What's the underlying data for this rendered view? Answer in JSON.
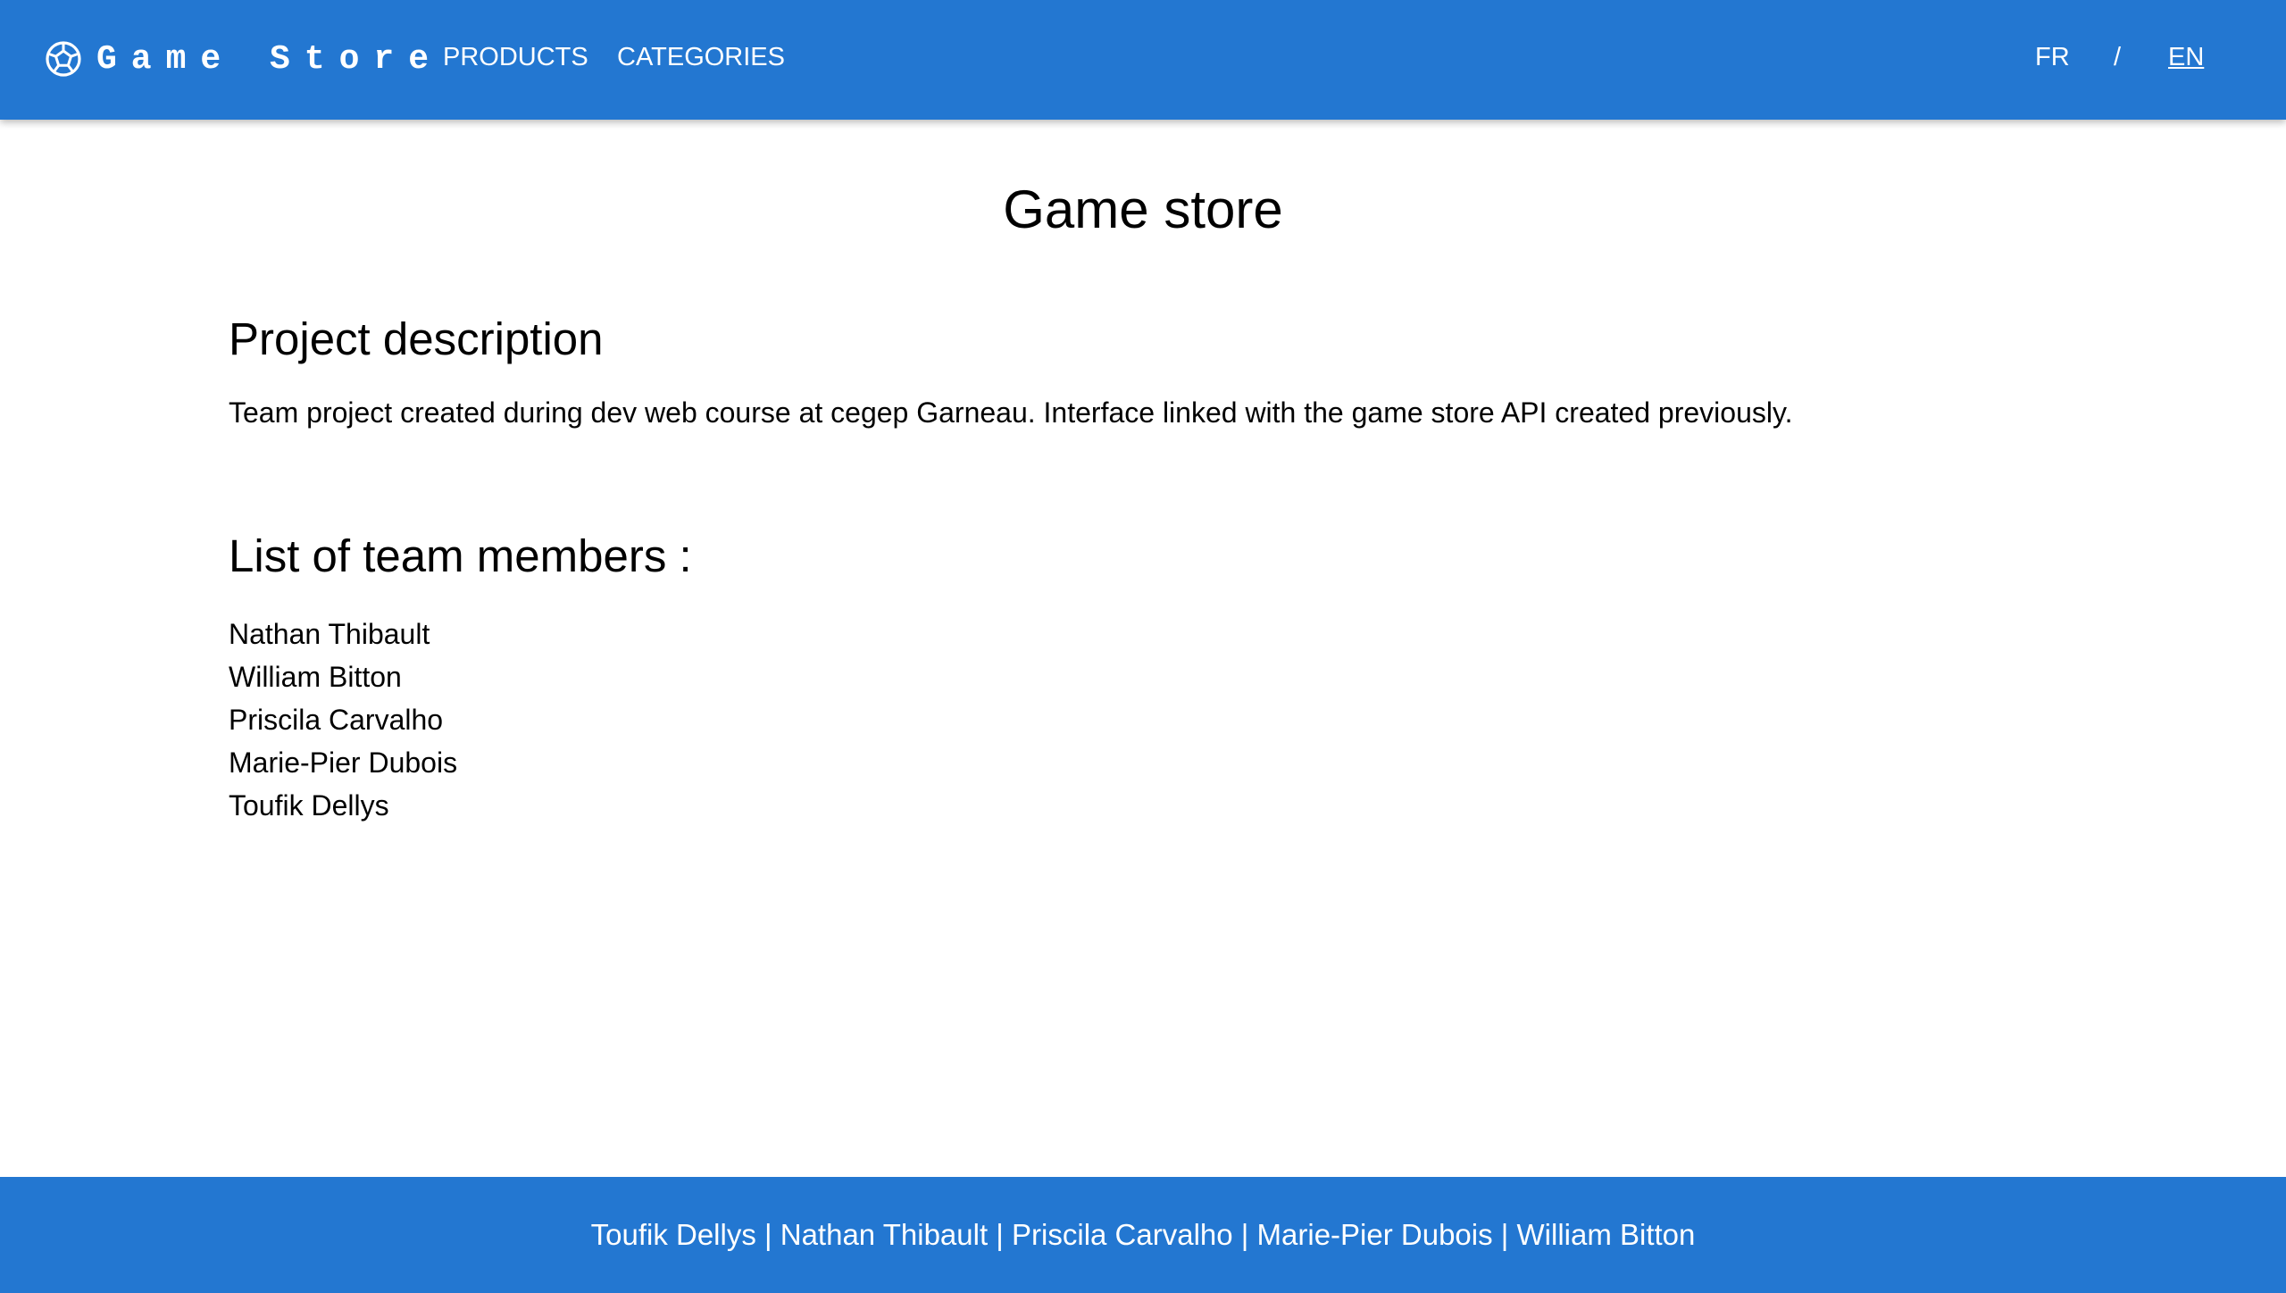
{
  "header": {
    "brand": "Game Store",
    "brand_icon": "soccer-ball-icon",
    "nav": {
      "products": "PRODUCTS",
      "categories": "CATEGORIES"
    },
    "lang": {
      "fr": "FR",
      "separator": "/",
      "en": "EN",
      "active": "EN"
    },
    "color": "#2377d1"
  },
  "main": {
    "title": "Game store",
    "description": {
      "heading": "Project description",
      "text": "Team project created during dev web course at cegep Garneau. Interface linked with the game store API created previously."
    },
    "members": {
      "heading": "List of team members :",
      "items": [
        "Nathan Thibault",
        "William Bitton",
        "Priscila Carvalho",
        "Marie-Pier Dubois",
        "Toufik Dellys"
      ]
    }
  },
  "footer": {
    "text": "Toufik Dellys | Nathan Thibault | Priscila Carvalho | Marie-Pier Dubois | William Bitton"
  }
}
